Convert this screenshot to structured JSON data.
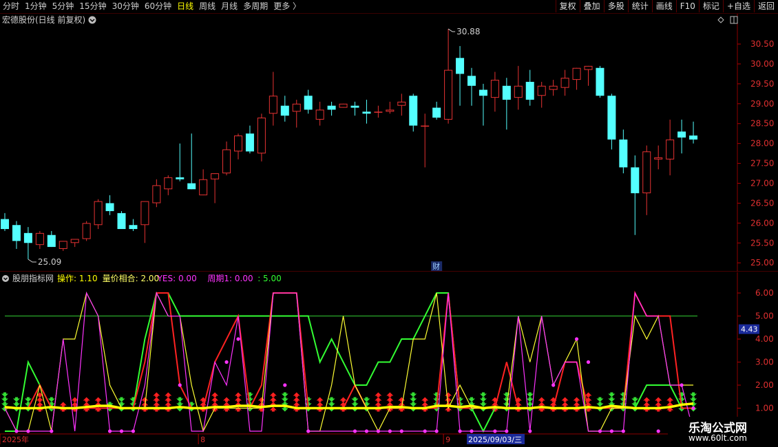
{
  "toolbar": {
    "periods": [
      "分时",
      "1分钟",
      "5分钟",
      "15分钟",
      "30分钟",
      "60分钟",
      "日线",
      "周线",
      "月线",
      "多周期",
      "更多 〉"
    ],
    "active_period": "日线",
    "tools": [
      "复权",
      "叠加",
      "多股",
      "统计",
      "画线",
      "F10",
      "标记",
      "+自选",
      "返回"
    ]
  },
  "chart_header": {
    "title": "宏德股份(日线 前复权)",
    "dropdown_icon": "chevron-down-circle-icon",
    "diamond_icon": "diamond-icon",
    "panel_icon": "panel-toggle-icon"
  },
  "price_axis": {
    "ticks": [
      "30.50",
      "30.00",
      "29.50",
      "29.00",
      "28.50",
      "28.00",
      "27.50",
      "27.00",
      "26.50",
      "26.00",
      "25.50",
      "25.00"
    ],
    "ylim": [
      24.9,
      30.95
    ]
  },
  "annotations": {
    "high_label": "30.88",
    "low_label": "25.09",
    "event_badge": "财"
  },
  "chart_data": [
    {
      "type": "candlestick",
      "title": "宏德股份(日线 前复权)",
      "ylim": [
        24.9,
        30.95
      ],
      "colors": {
        "up": "#e63232",
        "down": "#54ffff"
      },
      "ohlc": [
        [
          26.1,
          26.25,
          25.8,
          25.85
        ],
        [
          25.95,
          26.05,
          25.35,
          25.55
        ],
        [
          25.75,
          25.9,
          25.09,
          25.5
        ],
        [
          25.45,
          25.8,
          25.35,
          25.75
        ],
        [
          25.7,
          25.8,
          25.4,
          25.4
        ],
        [
          25.35,
          25.55,
          25.3,
          25.55
        ],
        [
          25.5,
          25.6,
          25.4,
          25.6
        ],
        [
          25.6,
          26.05,
          25.55,
          26.0
        ],
        [
          25.95,
          26.6,
          25.85,
          26.55
        ],
        [
          26.5,
          26.7,
          26.2,
          26.3
        ],
        [
          26.25,
          26.3,
          25.85,
          25.85
        ],
        [
          25.95,
          26.1,
          25.8,
          25.85
        ],
        [
          25.95,
          26.55,
          25.5,
          26.55
        ],
        [
          26.5,
          27.1,
          26.4,
          26.95
        ],
        [
          26.85,
          27.2,
          26.7,
          27.15
        ],
        [
          27.15,
          28.0,
          27.05,
          27.1
        ],
        [
          27.0,
          28.25,
          26.85,
          26.85
        ],
        [
          26.7,
          27.35,
          26.7,
          27.1
        ],
        [
          27.1,
          27.25,
          26.5,
          27.25
        ],
        [
          27.25,
          28.05,
          27.2,
          27.85
        ],
        [
          27.8,
          28.25,
          27.6,
          28.2
        ],
        [
          28.25,
          28.45,
          27.75,
          27.8
        ],
        [
          27.75,
          28.75,
          27.55,
          28.65
        ],
        [
          28.75,
          29.8,
          28.45,
          29.2
        ],
        [
          28.95,
          29.2,
          28.55,
          28.7
        ],
        [
          28.8,
          29.1,
          28.4,
          29.0
        ],
        [
          29.2,
          29.35,
          28.75,
          28.85
        ],
        [
          28.6,
          29.05,
          28.45,
          28.85
        ],
        [
          28.95,
          29.05,
          28.7,
          28.85
        ],
        [
          28.9,
          29.0,
          28.9,
          29.0
        ],
        [
          28.95,
          29.05,
          28.7,
          28.9
        ],
        [
          28.8,
          29.1,
          28.5,
          28.75
        ],
        [
          28.8,
          28.95,
          28.65,
          28.8
        ],
        [
          28.8,
          29.05,
          28.75,
          28.85
        ],
        [
          28.95,
          29.25,
          28.7,
          29.05
        ],
        [
          29.2,
          29.25,
          28.3,
          28.45
        ],
        [
          28.45,
          28.75,
          27.4,
          28.45
        ],
        [
          28.9,
          29.05,
          28.6,
          28.65
        ],
        [
          28.6,
          30.88,
          28.5,
          29.85
        ],
        [
          30.15,
          30.45,
          28.95,
          29.75
        ],
        [
          29.7,
          29.9,
          28.95,
          29.45
        ],
        [
          29.35,
          29.5,
          28.45,
          29.2
        ],
        [
          29.15,
          29.8,
          28.8,
          29.6
        ],
        [
          29.45,
          29.65,
          28.35,
          29.1
        ],
        [
          29.15,
          29.95,
          28.85,
          29.45
        ],
        [
          29.55,
          29.85,
          28.95,
          29.1
        ],
        [
          29.2,
          29.55,
          28.9,
          29.45
        ],
        [
          29.35,
          29.6,
          29.2,
          29.45
        ],
        [
          29.4,
          29.85,
          29.2,
          29.65
        ],
        [
          29.6,
          29.9,
          29.35,
          29.9
        ],
        [
          29.85,
          29.95,
          29.45,
          29.95
        ],
        [
          29.9,
          29.95,
          29.15,
          29.2
        ],
        [
          29.2,
          29.25,
          27.85,
          28.1
        ],
        [
          28.1,
          28.35,
          27.25,
          27.4
        ],
        [
          27.4,
          27.7,
          25.7,
          26.75
        ],
        [
          26.75,
          27.95,
          26.2,
          27.8
        ],
        [
          27.6,
          27.95,
          27.35,
          27.65
        ],
        [
          27.6,
          28.6,
          27.2,
          28.1
        ],
        [
          28.3,
          28.6,
          27.75,
          28.15
        ],
        [
          28.2,
          28.55,
          28.0,
          28.1
        ]
      ]
    },
    {
      "type": "line",
      "title": "股朋指标网",
      "legend": [
        {
          "label": "操作: 1.10",
          "color": "#ffff00"
        },
        {
          "label": "量价相合: 2.00",
          "color": "#ffff66"
        },
        {
          "label": "YES: 0.00",
          "color": "#ff33ff"
        },
        {
          "label": "周期1: 0.00",
          "color": "#ff33ff"
        },
        {
          "label": ": 5.00",
          "color": "#33ff33"
        }
      ],
      "y_ticks": [
        "6.00",
        "5.00",
        "4.00",
        "3.00",
        "2.00",
        "1.00"
      ],
      "ylim": [
        0.0,
        6.3
      ],
      "reference_line": 5.0,
      "current_value_label": "4.43",
      "series": [
        {
          "color": "#33ff33",
          "values": [
            0,
            0,
            3,
            2,
            1,
            1,
            1,
            1,
            1,
            1,
            1,
            1,
            4,
            6,
            6,
            5,
            5,
            5,
            5,
            5,
            5,
            5,
            5,
            5,
            5,
            5,
            5,
            3,
            4,
            3,
            2,
            2,
            3,
            3,
            4,
            4,
            5,
            6,
            6,
            1,
            1,
            0,
            1,
            1,
            1,
            1,
            1,
            1,
            1,
            1,
            1,
            1,
            1,
            1,
            1,
            2,
            2,
            2,
            1,
            1
          ]
        },
        {
          "color": "#ff2222",
          "values": [
            1,
            1,
            1,
            2,
            1,
            1,
            1,
            1,
            1,
            1,
            1,
            1,
            3,
            6,
            6,
            2,
            1,
            1,
            3,
            4,
            5,
            1,
            2,
            6,
            6,
            6,
            1,
            1,
            1,
            1,
            2,
            1,
            1,
            1,
            1,
            1,
            1,
            1,
            6,
            1,
            1,
            1,
            1,
            3,
            1,
            1,
            1,
            1,
            3,
            3,
            1,
            1,
            1,
            1,
            6,
            5,
            5,
            5,
            1,
            1
          ]
        },
        {
          "color": "#ffff33",
          "values": [
            1,
            0,
            0,
            2,
            0,
            4,
            4,
            6,
            5,
            2,
            1,
            1,
            1,
            6,
            5,
            5,
            2,
            0,
            1,
            1,
            1,
            1,
            1,
            6,
            6,
            6,
            0,
            0,
            2,
            5,
            2,
            1,
            0,
            1,
            1,
            4,
            4,
            6,
            1,
            2,
            1,
            1,
            1,
            1,
            5,
            3,
            5,
            2,
            3,
            4,
            0,
            0,
            1,
            1,
            5,
            4,
            5,
            2,
            2,
            2
          ]
        },
        {
          "color": "#ff33ff",
          "values": [
            1,
            0,
            0,
            0,
            0,
            4,
            0,
            6,
            5,
            0,
            0,
            0,
            2,
            6,
            5,
            5,
            0,
            0,
            3,
            2,
            5,
            0,
            0,
            6,
            6,
            6,
            0,
            0,
            0,
            0,
            0,
            0,
            0,
            0,
            0,
            0,
            0,
            0,
            6,
            0,
            0,
            0,
            0,
            0,
            5,
            0,
            5,
            2,
            3,
            3,
            0,
            0,
            0,
            0,
            6,
            5,
            5,
            2,
            2,
            0
          ]
        }
      ],
      "moving_average": {
        "color": "#ffff00",
        "values": [
          1.05,
          1.0,
          1.0,
          1.0,
          1.05,
          1.0,
          1.0,
          1.05,
          1.1,
          1.1,
          1.0,
          1.0,
          1.0,
          1.0,
          1.0,
          1.05,
          1.0,
          1.0,
          1.05,
          1.05,
          1.1,
          1.1,
          1.05,
          1.1,
          1.1,
          1.0,
          1.0,
          1.0,
          1.0,
          1.0,
          1.0,
          1.0,
          1.0,
          1.05,
          1.05,
          1.0,
          1.0,
          1.1,
          1.1,
          1.05,
          1.1,
          1.0,
          1.05,
          1.0,
          1.0,
          1.0,
          1.05,
          1.0,
          1.0,
          1.0,
          1.05,
          1.0,
          1.1,
          1.05,
          1.0,
          1.0,
          1.0,
          1.05,
          1.15,
          1.2
        ]
      },
      "markers": {
        "color": "#ff33ff",
        "values": [
          null,
          0,
          0,
          null,
          0,
          null,
          null,
          null,
          null,
          0,
          0,
          0,
          null,
          null,
          null,
          2,
          null,
          null,
          null,
          3,
          4,
          null,
          null,
          null,
          2,
          null,
          0,
          null,
          null,
          null,
          0,
          0,
          0,
          0,
          0,
          null,
          0,
          0,
          null,
          0,
          0,
          null,
          0,
          0,
          null,
          0,
          null,
          2,
          null,
          4,
          3,
          0,
          0,
          0,
          null,
          null,
          0,
          null,
          2,
          1
        ]
      },
      "signal_bars": {
        "colors": {
          "buy": "#ff2020",
          "sell": "#33dd33"
        },
        "heights": [
          4,
          3,
          3,
          4,
          3,
          2,
          3,
          3,
          3,
          2,
          3,
          3,
          3,
          4,
          4,
          3,
          2,
          3,
          4,
          3,
          4,
          4,
          3,
          4,
          4,
          4,
          3,
          3,
          3,
          3,
          3,
          3,
          4,
          4,
          3,
          4,
          3,
          4,
          4,
          3,
          3,
          4,
          3,
          4,
          3,
          4,
          3,
          3,
          3,
          3,
          4,
          3,
          4,
          4,
          3,
          3,
          3,
          3,
          4,
          4
        ]
      }
    }
  ],
  "date_axis": {
    "labels": [
      {
        "text": "2025年",
        "candle": 0
      },
      {
        "text": "8",
        "candle": 17
      },
      {
        "text": "9",
        "candle": 38
      },
      {
        "text": "2025/09/03/三",
        "candle": 40,
        "highlight": true
      }
    ]
  },
  "watermark": {
    "text": "乐淘公式网",
    "url": "www.60lt.com"
  }
}
